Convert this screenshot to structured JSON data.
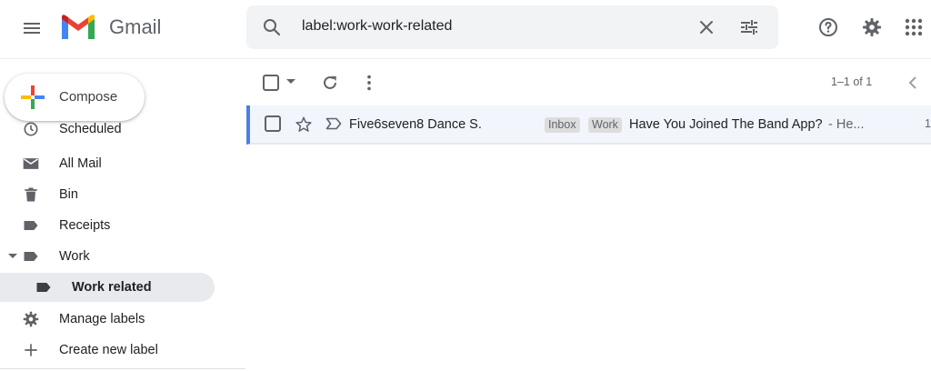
{
  "app": {
    "name": "Gmail"
  },
  "search": {
    "query": "label:work-work-related"
  },
  "compose": {
    "label": "Compose"
  },
  "sidebar": {
    "items": [
      {
        "label": "Scheduled",
        "icon": "scheduled-icon"
      },
      {
        "label": "All Mail",
        "icon": "all-mail-icon"
      },
      {
        "label": "Bin",
        "icon": "bin-icon"
      },
      {
        "label": "Receipts",
        "icon": "label-icon"
      },
      {
        "label": "Work",
        "icon": "label-icon"
      },
      {
        "label": "Work related",
        "icon": "label-icon",
        "active": true
      },
      {
        "label": "Manage labels",
        "icon": "gear-icon"
      },
      {
        "label": "Create new label",
        "icon": "plus-icon"
      }
    ]
  },
  "toolbar": {
    "pagination": "1–1 of 1"
  },
  "emails": [
    {
      "sender": "Five6seven8 Dance S.",
      "labels": [
        "Inbox",
        "Work"
      ],
      "subject": "Have You Joined The Band App?",
      "snippet": " - He...",
      "date": "1"
    }
  ],
  "colors": {
    "accent": "#4a80e6",
    "active_nav": "#e8eaed",
    "search_bg": "#f1f3f4",
    "row_bg": "#f2f6fc"
  }
}
